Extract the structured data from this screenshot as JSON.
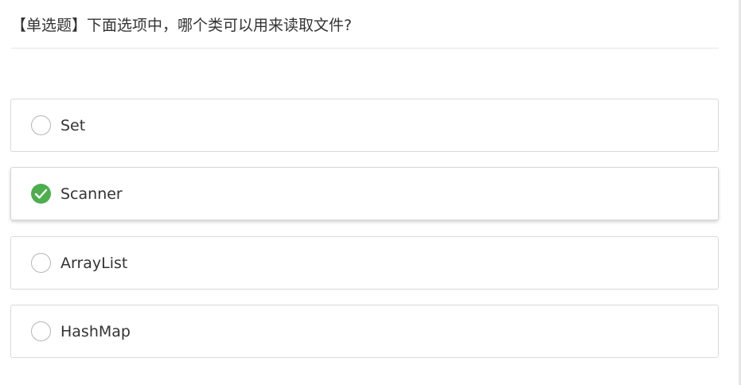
{
  "question": {
    "title": "【单选题】下面选项中，哪个类可以用来读取文件?"
  },
  "options": [
    {
      "label": "Set",
      "selected": false
    },
    {
      "label": "Scanner",
      "selected": true
    },
    {
      "label": "ArrayList",
      "selected": false
    },
    {
      "label": "HashMap",
      "selected": false
    }
  ],
  "colors": {
    "accent": "#4cae4c",
    "border": "#d9d9d9",
    "text": "#333333"
  },
  "icons": {
    "selected": "check-circle-icon",
    "unselected": "radio-circle-icon"
  }
}
